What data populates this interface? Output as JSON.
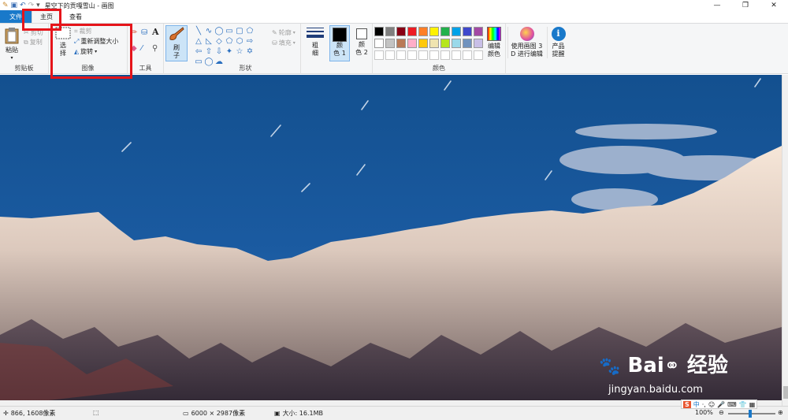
{
  "window": {
    "title": "星空下的贡嘎雪山 - 画图",
    "controls": {
      "minimize": "—",
      "maximize": "❐",
      "close": "✕"
    }
  },
  "tabs": [
    {
      "label": "文件"
    },
    {
      "label": "主页"
    },
    {
      "label": "查看"
    }
  ],
  "ribbon": {
    "clipboard": {
      "paste": "粘贴",
      "cut": "剪切",
      "copy": "复制",
      "group_label": "剪贴板"
    },
    "image": {
      "select_line1": "选",
      "select_line2": "择",
      "crop": "裁剪",
      "resize": "重新调整大小",
      "rotate": "旋转",
      "group_label": "图像"
    },
    "tools": {
      "group_label": "工具",
      "text_icon": "A"
    },
    "brushes": {
      "line1": "刷",
      "line2": "子"
    },
    "shapes": {
      "outline": "轮廓",
      "fill": "填充",
      "group_label": "形状"
    },
    "size": {
      "line1": "粗",
      "line2": "细"
    },
    "color1": {
      "line1": "颜",
      "line2": "色 1"
    },
    "color2": {
      "line1": "颜",
      "line2": "色 2"
    },
    "colors": {
      "group_label": "颜色",
      "palette_row1": [
        "#000000",
        "#7f7f7f",
        "#880015",
        "#ed1c24",
        "#ff7f27",
        "#fff200",
        "#22b14c",
        "#00a2e8",
        "#3f48cc",
        "#a349a4"
      ],
      "palette_row2": [
        "#ffffff",
        "#c3c3c3",
        "#b97a57",
        "#ffaec9",
        "#ffc90e",
        "#efe4b0",
        "#b5e61d",
        "#99d9ea",
        "#7092be",
        "#c8bfe7"
      ],
      "edit_line1": "编辑",
      "edit_line2": "颜色"
    },
    "paint3d": {
      "line1": "使用画图 3",
      "line2": "D 进行编辑"
    },
    "product_alert": {
      "line1": "产品",
      "line2": "提醒",
      "icon": "i"
    }
  },
  "watermark": {
    "brand": "Bai",
    "brand_cn": "经验",
    "url": "jingyan.baidu.com"
  },
  "statusbar": {
    "cursor_pos": "866, 1608像素",
    "image_size": "6000 × 2987像素",
    "file_size": "大小: 16.1MB",
    "zoom": "100%",
    "ime": "中"
  }
}
